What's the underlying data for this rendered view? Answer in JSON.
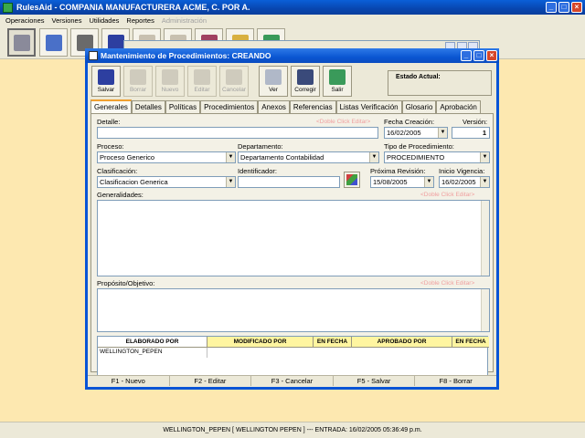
{
  "app": {
    "title": "RulesAid  - COMPANIA MANUFACTURERA ACME, C. POR A."
  },
  "menu": [
    {
      "label": "Operaciones",
      "enabled": true
    },
    {
      "label": "Versiones",
      "enabled": true
    },
    {
      "label": "Utilidades",
      "enabled": true
    },
    {
      "label": "Reportes",
      "enabled": true
    },
    {
      "label": "Administración",
      "enabled": false
    }
  ],
  "main_toolbar_icons": [
    "procedures-icon",
    "document-icon",
    "stamp-icon",
    "floppy-icon",
    "users-icon",
    "hand-icon",
    "book-icon",
    "pencil-icon",
    "exit-door-icon"
  ],
  "dialog": {
    "title": "Mantenimiento de Procedimientos: CREANDO",
    "toolbar": [
      {
        "label": "Salvar",
        "icon": "save-icon",
        "enabled": true
      },
      {
        "label": "Borrar",
        "icon": "trash-icon",
        "enabled": false
      },
      {
        "label": "Nuevo",
        "icon": "new-icon",
        "enabled": false
      },
      {
        "label": "Editar",
        "icon": "edit-icon",
        "enabled": false
      },
      {
        "label": "Cancelar",
        "icon": "cancel-icon",
        "enabled": false
      },
      {
        "label": "Ver",
        "icon": "view-icon",
        "enabled": true
      },
      {
        "label": "Corregir",
        "icon": "correct-icon",
        "enabled": true
      },
      {
        "label": "Salir",
        "icon": "exit-icon",
        "enabled": true
      }
    ],
    "estado_label": "Estado Actual:",
    "tabs": [
      "Generales",
      "Detalles",
      "Políticas",
      "Procedimientos",
      "Anexos",
      "Referencias",
      "Listas Verificación",
      "Glosario",
      "Aprobación"
    ],
    "active_tab": "Generales",
    "form": {
      "detalle_label": "Detalle:",
      "detalle_hint": "<Doble Click Editar>",
      "detalle_value": "",
      "fecha_creacion_label": "Fecha Creación:",
      "fecha_creacion_value": "16/02/2005",
      "version_label": "Versión:",
      "version_value": "1",
      "proceso_label": "Proceso:",
      "proceso_value": "Proceso Generico",
      "departamento_label": "Departamento:",
      "departamento_value": "Departamento Contabilidad",
      "tipo_label": "Tipo de Procedimiento:",
      "tipo_value": "PROCEDIMIENTO",
      "clasificacion_label": "Clasificación:",
      "clasificacion_value": "Clasificacion Generica",
      "identificador_label": "Identificador:",
      "identificador_value": "",
      "proxima_revision_label": "Próxima Revisión:",
      "proxima_revision_value": "15/08/2005",
      "inicio_vigencia_label": "Inicio Vigencia:",
      "inicio_vigencia_value": "16/02/2005",
      "generalidades_label": "Generalidades:",
      "generalidades_hint": "<Doble Click Editar>",
      "proposito_label": "Propósito/Objetivo:",
      "proposito_hint": "<Doble Click Editar>"
    },
    "grid": {
      "headers": [
        "ELABORADO POR",
        "MODIFICADO POR",
        "EN FECHA",
        "APROBADO POR",
        "EN FECHA"
      ],
      "row": [
        "WELLINGTON_PEPEN",
        "",
        "",
        "",
        ""
      ]
    },
    "fkeys": [
      "F1 - Nuevo",
      "F2 - Editar",
      "F3 - Cancelar",
      "F5 - Salvar",
      "F8 - Borrar"
    ]
  },
  "status": {
    "text": "WELLINGTON_PEPEN [ WELLINGTON PEPEN ] --- ENTRADA: 16/02/2005 05:36:49 p.m."
  },
  "colors": {
    "workspace": "#fde8b0",
    "title_bar": "#0a56d2",
    "grid_header_highlight": "#fff5a0",
    "hint_text": "#f0a0a0"
  }
}
